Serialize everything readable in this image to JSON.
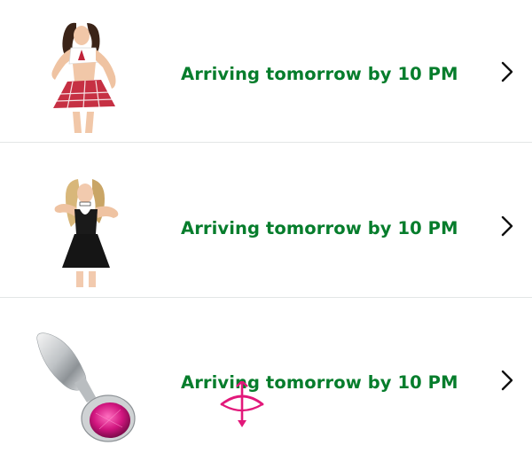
{
  "orders": [
    {
      "image": "schoolgirl-lingerie-costume",
      "status": "Arriving tomorrow by 10 PM",
      "chevron_icon": "chevron-right-icon"
    },
    {
      "image": "maid-lingerie-costume",
      "status": "Arriving tomorrow by 10 PM",
      "chevron_icon": "chevron-right-icon"
    },
    {
      "image": "metal-plug-with-pink-gem",
      "status": "Arriving tomorrow by 10 PM",
      "chevron_icon": "chevron-right-icon"
    }
  ],
  "colors": {
    "status_green": "#067d2c",
    "divider": "#e3e6e6",
    "cursor_pink": "#e2187a"
  },
  "cursor_icon": "cupid-bow-arrow-cursor-icon"
}
